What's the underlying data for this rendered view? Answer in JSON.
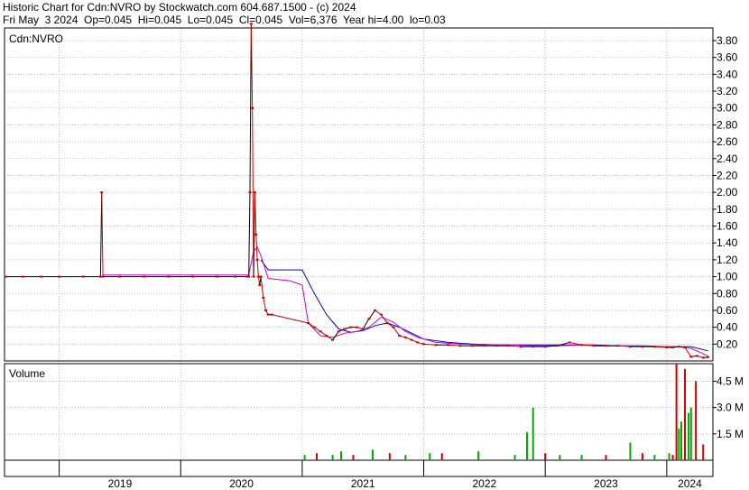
{
  "header": {
    "line1": "Historic Chart for Cdn:NVRO by Stockwatch.com 604.687.1500 - (c) 2024",
    "line2": "Fri May  3 2024  Op=0.045  Hi=0.045  Lo=0.045  Cl=0.045  Vol=6,376  Year hi=4.00  lo=0.03"
  },
  "chart_data": {
    "type": "line",
    "symbol_label": "Cdn:NVRO",
    "volume_label": "Volume",
    "price_ticks": [
      "0.20",
      "0.40",
      "0.60",
      "0.80",
      "1.00",
      "1.20",
      "1.40",
      "1.60",
      "1.80",
      "2.00",
      "2.20",
      "2.40",
      "2.60",
      "2.80",
      "3.00",
      "3.20",
      "3.40",
      "3.60",
      "3.80"
    ],
    "volume_ticks": [
      "1.5 M",
      "3.0 M",
      "4.5 M"
    ],
    "x_labels": [
      "2019",
      "2020",
      "2021",
      "2022",
      "2023",
      "2024"
    ],
    "ylim_price": [
      0,
      3.95
    ],
    "ylim_volume": [
      0,
      5.5
    ],
    "xlim": [
      2018.55,
      2024.38
    ],
    "year_boundaries": [
      2019.0,
      2020.0,
      2021.0,
      2022.0,
      2023.0,
      2024.0
    ],
    "colors": {
      "price": "#000000",
      "price_down": "#cc0000",
      "ma_short": "#cc00cc",
      "ma_long": "#0000cc",
      "vol_up": "#00aa00",
      "vol_down": "#cc0000",
      "grid": "#bbbbbb"
    },
    "price_series": {
      "name": "",
      "x": [
        2018.56,
        2018.7,
        2018.85,
        2019.0,
        2019.2,
        2019.34,
        2019.35,
        2019.36,
        2019.5,
        2019.7,
        2019.9,
        2020.1,
        2020.3,
        2020.45,
        2020.55,
        2020.56,
        2020.57,
        2020.58,
        2020.59,
        2020.6,
        2020.61,
        2020.62,
        2020.63,
        2020.64,
        2020.65,
        2020.66,
        2020.68,
        2020.7,
        2020.72,
        2020.75,
        2021.05,
        2021.1,
        2021.15,
        2021.2,
        2021.25,
        2021.3,
        2021.35,
        2021.4,
        2021.45,
        2021.5,
        2021.55,
        2021.6,
        2021.65,
        2021.7,
        2021.75,
        2021.8,
        2021.85,
        2021.9,
        2021.95,
        2022.0,
        2022.1,
        2022.2,
        2022.3,
        2022.4,
        2022.5,
        2022.6,
        2022.7,
        2022.8,
        2022.9,
        2023.0,
        2023.1,
        2023.2,
        2023.3,
        2023.4,
        2023.5,
        2023.6,
        2023.7,
        2023.8,
        2023.9,
        2024.0,
        2024.05,
        2024.1,
        2024.15,
        2024.2,
        2024.25,
        2024.3,
        2024.34
      ],
      "y": [
        1.0,
        1.0,
        1.0,
        1.0,
        1.0,
        1.0,
        2.0,
        1.0,
        1.0,
        1.0,
        1.0,
        1.0,
        1.0,
        1.0,
        1.0,
        1.0,
        2.0,
        4.0,
        3.0,
        1.0,
        2.0,
        1.5,
        1.2,
        1.0,
        0.9,
        1.0,
        0.75,
        0.6,
        0.55,
        0.55,
        0.45,
        0.4,
        0.35,
        0.3,
        0.25,
        0.35,
        0.38,
        0.4,
        0.4,
        0.38,
        0.5,
        0.6,
        0.55,
        0.45,
        0.4,
        0.3,
        0.28,
        0.25,
        0.22,
        0.2,
        0.19,
        0.19,
        0.18,
        0.18,
        0.18,
        0.18,
        0.18,
        0.17,
        0.17,
        0.17,
        0.18,
        0.22,
        0.19,
        0.18,
        0.18,
        0.18,
        0.17,
        0.17,
        0.17,
        0.16,
        0.16,
        0.17,
        0.16,
        0.05,
        0.06,
        0.04,
        0.045
      ]
    },
    "ma_short": {
      "name": "",
      "x": [
        2019.36,
        2020.56,
        2020.6,
        2020.63,
        2020.66,
        2020.72,
        2020.9,
        2021.0,
        2021.05,
        2021.15,
        2021.25,
        2021.35,
        2021.45,
        2021.55,
        2021.65,
        2021.75,
        2021.85,
        2021.95,
        2022.1,
        2022.3,
        2022.5,
        2022.7,
        2022.9,
        2023.1,
        2023.3,
        2023.5,
        2023.7,
        2023.9,
        2024.1,
        2024.2,
        2024.34
      ],
      "y": [
        1.02,
        1.02,
        1.3,
        1.35,
        1.25,
        0.98,
        0.95,
        0.9,
        0.45,
        0.3,
        0.28,
        0.33,
        0.35,
        0.4,
        0.52,
        0.46,
        0.35,
        0.28,
        0.22,
        0.2,
        0.19,
        0.19,
        0.18,
        0.18,
        0.19,
        0.18,
        0.18,
        0.17,
        0.17,
        0.15,
        0.06
      ]
    },
    "ma_long": {
      "name": "",
      "x": [
        2020.66,
        2020.72,
        2021.0,
        2021.1,
        2021.2,
        2021.3,
        2021.4,
        2021.5,
        2021.6,
        2021.7,
        2021.8,
        2021.9,
        2022.0,
        2022.2,
        2022.4,
        2022.6,
        2022.8,
        2023.0,
        2023.2,
        2023.4,
        2023.6,
        2023.8,
        2024.0,
        2024.2,
        2024.34
      ],
      "y": [
        1.2,
        1.08,
        1.08,
        0.8,
        0.55,
        0.38,
        0.34,
        0.36,
        0.42,
        0.45,
        0.4,
        0.33,
        0.26,
        0.22,
        0.2,
        0.19,
        0.19,
        0.19,
        0.19,
        0.19,
        0.18,
        0.18,
        0.17,
        0.17,
        0.12
      ]
    },
    "volume": {
      "x": [
        2021.02,
        2021.12,
        2021.25,
        2021.32,
        2021.42,
        2021.58,
        2021.72,
        2021.85,
        2022.05,
        2022.15,
        2022.45,
        2022.75,
        2022.85,
        2022.9,
        2023.0,
        2023.12,
        2023.3,
        2023.5,
        2023.7,
        2023.8,
        2023.9,
        2024.02,
        2024.05,
        2024.08,
        2024.1,
        2024.12,
        2024.15,
        2024.18,
        2024.2,
        2024.24,
        2024.3
      ],
      "y": [
        0.3,
        0.4,
        0.3,
        0.5,
        0.3,
        0.6,
        0.4,
        0.3,
        0.4,
        0.4,
        0.5,
        0.3,
        1.6,
        3.0,
        0.4,
        0.3,
        0.3,
        0.3,
        1.0,
        0.4,
        0.3,
        0.4,
        0.3,
        5.5,
        1.8,
        2.2,
        5.2,
        2.7,
        3.0,
        4.5,
        0.9
      ],
      "up": [
        true,
        false,
        true,
        true,
        false,
        true,
        false,
        true,
        true,
        false,
        true,
        true,
        true,
        true,
        false,
        true,
        true,
        false,
        true,
        false,
        true,
        true,
        false,
        false,
        true,
        true,
        false,
        true,
        true,
        false,
        false
      ]
    }
  }
}
